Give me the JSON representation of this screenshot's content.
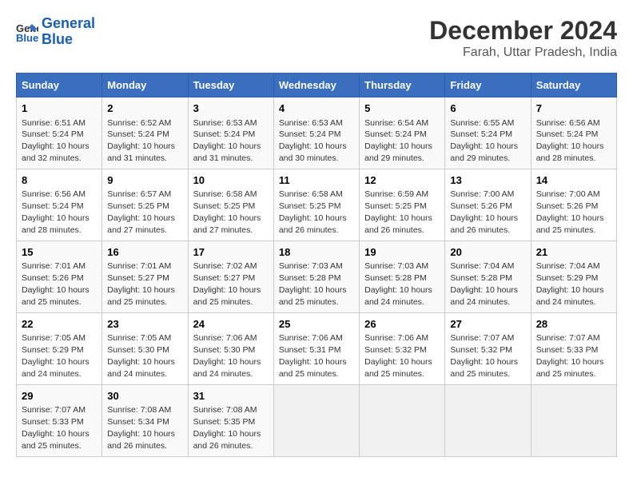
{
  "header": {
    "logo_line1": "General",
    "logo_line2": "Blue",
    "main_title": "December 2024",
    "subtitle": "Farah, Uttar Pradesh, India"
  },
  "calendar": {
    "days_of_week": [
      "Sunday",
      "Monday",
      "Tuesday",
      "Wednesday",
      "Thursday",
      "Friday",
      "Saturday"
    ],
    "weeks": [
      [
        {
          "day": "1",
          "sunrise": "6:51 AM",
          "sunset": "5:24 PM",
          "daylight": "10 hours and 32 minutes."
        },
        {
          "day": "2",
          "sunrise": "6:52 AM",
          "sunset": "5:24 PM",
          "daylight": "10 hours and 31 minutes."
        },
        {
          "day": "3",
          "sunrise": "6:53 AM",
          "sunset": "5:24 PM",
          "daylight": "10 hours and 31 minutes."
        },
        {
          "day": "4",
          "sunrise": "6:53 AM",
          "sunset": "5:24 PM",
          "daylight": "10 hours and 30 minutes."
        },
        {
          "day": "5",
          "sunrise": "6:54 AM",
          "sunset": "5:24 PM",
          "daylight": "10 hours and 29 minutes."
        },
        {
          "day": "6",
          "sunrise": "6:55 AM",
          "sunset": "5:24 PM",
          "daylight": "10 hours and 29 minutes."
        },
        {
          "day": "7",
          "sunrise": "6:56 AM",
          "sunset": "5:24 PM",
          "daylight": "10 hours and 28 minutes."
        }
      ],
      [
        {
          "day": "8",
          "sunrise": "6:56 AM",
          "sunset": "5:24 PM",
          "daylight": "10 hours and 28 minutes."
        },
        {
          "day": "9",
          "sunrise": "6:57 AM",
          "sunset": "5:25 PM",
          "daylight": "10 hours and 27 minutes."
        },
        {
          "day": "10",
          "sunrise": "6:58 AM",
          "sunset": "5:25 PM",
          "daylight": "10 hours and 27 minutes."
        },
        {
          "day": "11",
          "sunrise": "6:58 AM",
          "sunset": "5:25 PM",
          "daylight": "10 hours and 26 minutes."
        },
        {
          "day": "12",
          "sunrise": "6:59 AM",
          "sunset": "5:25 PM",
          "daylight": "10 hours and 26 minutes."
        },
        {
          "day": "13",
          "sunrise": "7:00 AM",
          "sunset": "5:26 PM",
          "daylight": "10 hours and 26 minutes."
        },
        {
          "day": "14",
          "sunrise": "7:00 AM",
          "sunset": "5:26 PM",
          "daylight": "10 hours and 25 minutes."
        }
      ],
      [
        {
          "day": "15",
          "sunrise": "7:01 AM",
          "sunset": "5:26 PM",
          "daylight": "10 hours and 25 minutes."
        },
        {
          "day": "16",
          "sunrise": "7:01 AM",
          "sunset": "5:27 PM",
          "daylight": "10 hours and 25 minutes."
        },
        {
          "day": "17",
          "sunrise": "7:02 AM",
          "sunset": "5:27 PM",
          "daylight": "10 hours and 25 minutes."
        },
        {
          "day": "18",
          "sunrise": "7:03 AM",
          "sunset": "5:28 PM",
          "daylight": "10 hours and 25 minutes."
        },
        {
          "day": "19",
          "sunrise": "7:03 AM",
          "sunset": "5:28 PM",
          "daylight": "10 hours and 24 minutes."
        },
        {
          "day": "20",
          "sunrise": "7:04 AM",
          "sunset": "5:28 PM",
          "daylight": "10 hours and 24 minutes."
        },
        {
          "day": "21",
          "sunrise": "7:04 AM",
          "sunset": "5:29 PM",
          "daylight": "10 hours and 24 minutes."
        }
      ],
      [
        {
          "day": "22",
          "sunrise": "7:05 AM",
          "sunset": "5:29 PM",
          "daylight": "10 hours and 24 minutes."
        },
        {
          "day": "23",
          "sunrise": "7:05 AM",
          "sunset": "5:30 PM",
          "daylight": "10 hours and 24 minutes."
        },
        {
          "day": "24",
          "sunrise": "7:06 AM",
          "sunset": "5:30 PM",
          "daylight": "10 hours and 24 minutes."
        },
        {
          "day": "25",
          "sunrise": "7:06 AM",
          "sunset": "5:31 PM",
          "daylight": "10 hours and 25 minutes."
        },
        {
          "day": "26",
          "sunrise": "7:06 AM",
          "sunset": "5:32 PM",
          "daylight": "10 hours and 25 minutes."
        },
        {
          "day": "27",
          "sunrise": "7:07 AM",
          "sunset": "5:32 PM",
          "daylight": "10 hours and 25 minutes."
        },
        {
          "day": "28",
          "sunrise": "7:07 AM",
          "sunset": "5:33 PM",
          "daylight": "10 hours and 25 minutes."
        }
      ],
      [
        {
          "day": "29",
          "sunrise": "7:07 AM",
          "sunset": "5:33 PM",
          "daylight": "10 hours and 25 minutes."
        },
        {
          "day": "30",
          "sunrise": "7:08 AM",
          "sunset": "5:34 PM",
          "daylight": "10 hours and 26 minutes."
        },
        {
          "day": "31",
          "sunrise": "7:08 AM",
          "sunset": "5:35 PM",
          "daylight": "10 hours and 26 minutes."
        },
        null,
        null,
        null,
        null
      ]
    ]
  }
}
